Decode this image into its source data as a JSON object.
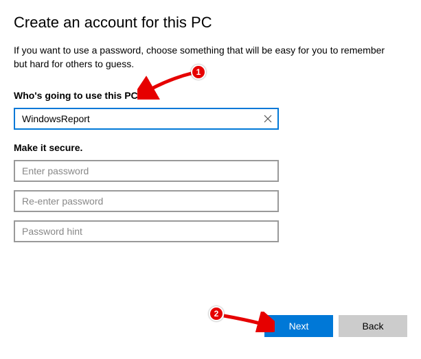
{
  "title": "Create an account for this PC",
  "description": "If you want to use a password, choose something that will be easy for you to remember but hard for others to guess.",
  "sections": {
    "who": {
      "label": "Who's going to use this PC?",
      "username_value": "WindowsReport"
    },
    "secure": {
      "label": "Make it secure.",
      "password_placeholder": "Enter password",
      "reenter_placeholder": "Re-enter password",
      "hint_placeholder": "Password hint"
    }
  },
  "buttons": {
    "next": "Next",
    "back": "Back"
  },
  "annotations": {
    "badge1": "1",
    "badge2": "2"
  }
}
